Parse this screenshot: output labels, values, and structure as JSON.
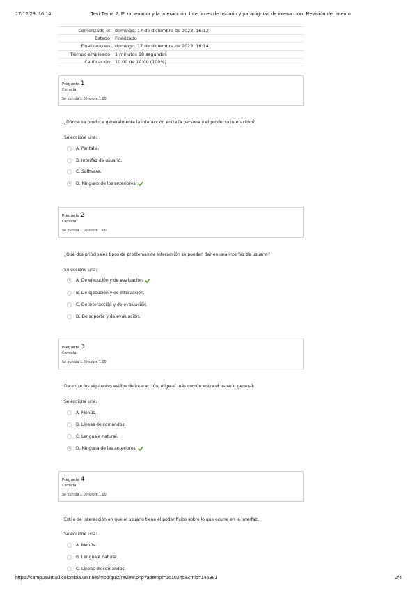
{
  "print_header": {
    "datetime": "17/12/23, 16:14",
    "title": "Test Tema 2. El ordenador y la interacción. Interfaces de usuario y paradigmas de interacción: Revisión del intento"
  },
  "summary": [
    {
      "label": "Comenzado el",
      "value": "domingo, 17 de diciembre de 2023, 16:12"
    },
    {
      "label": "Estado",
      "value": "Finalizado"
    },
    {
      "label": "Finalizado en",
      "value": "domingo, 17 de diciembre de 2023, 16:14"
    },
    {
      "label": "Tiempo empleado",
      "value": "1 minutos 18 segundos"
    },
    {
      "label": "Calificación",
      "value": "10.00 de 10.00 (100%)"
    }
  ],
  "questions": [
    {
      "prefix": "Pregunta",
      "number": "1",
      "state": "Correcta",
      "grade": "Se puntúa 1.00 sobre 1.00",
      "text": "¿Dónde se produce generalmente la interacción entre la persona y el producto interactivo?",
      "prompt": "Seleccione una:",
      "answers": [
        {
          "label": "A. Pantalla.",
          "selected": false,
          "correct": false
        },
        {
          "label": "B. Interfaz de usuario.",
          "selected": false,
          "correct": false
        },
        {
          "label": "C. Software.",
          "selected": false,
          "correct": false,
          "italic": "Software"
        },
        {
          "label": "D. Ninguno de los anteriores.",
          "selected": true,
          "correct": true
        }
      ]
    },
    {
      "prefix": "Pregunta",
      "number": "2",
      "state": "Correcta",
      "grade": "Se puntúa 1.00 sobre 1.00",
      "text": "¿Qué dos principales tipos de problemas de interacción se pueden dar en una interfaz de usuario?",
      "prompt": "Seleccione una:",
      "answers": [
        {
          "label": "A. De ejecución y de evaluación.",
          "selected": true,
          "correct": true
        },
        {
          "label": "B. De ejecución y de interacción.",
          "selected": false,
          "correct": false
        },
        {
          "label": "C. De interacción y de evaluación.",
          "selected": false,
          "correct": false
        },
        {
          "label": "D. De soporte y de evaluación.",
          "selected": false,
          "correct": false
        }
      ]
    },
    {
      "prefix": "Pregunta",
      "number": "3",
      "state": "Correcta",
      "grade": "Se puntúa 1.00 sobre 1.00",
      "text": "De entre los siguientes estilos de interacción, elige el más común entre el usuario general:",
      "prompt": "Seleccione una:",
      "answers": [
        {
          "label": "A. Menús.",
          "selected": false,
          "correct": false
        },
        {
          "label": "B. Líneas de comandos.",
          "selected": false,
          "correct": false
        },
        {
          "label": "C. Lenguaje natural.",
          "selected": false,
          "correct": false
        },
        {
          "label": "D. Ninguna de las anteriores.",
          "selected": true,
          "correct": true
        }
      ]
    },
    {
      "prefix": "Pregunta",
      "number": "4",
      "state": "Correcta",
      "grade": "Se puntúa 1.00 sobre 1.00",
      "text": "Estilo de interacción en que el usuario tiene el poder físico sobre lo que ocurre en la interfaz.",
      "prompt": "Seleccione una:",
      "answers": [
        {
          "label": "A. Menús.",
          "selected": false,
          "correct": false
        },
        {
          "label": "B. Lenguaje natural.",
          "selected": false,
          "correct": false
        },
        {
          "label": "C. Líneas de comandos.",
          "selected": false,
          "correct": false
        }
      ]
    }
  ],
  "print_footer": {
    "url": "https://campusvirtual.colombia.unir.net/mod/quiz/review.php?attempt=1610245&cmid=146981",
    "page": "2/4"
  },
  "colors": {
    "check": "#5a9a3c",
    "border": "#cfcfcf"
  },
  "icons": {
    "correct": "checkmark-icon",
    "option": "radio-circle"
  }
}
